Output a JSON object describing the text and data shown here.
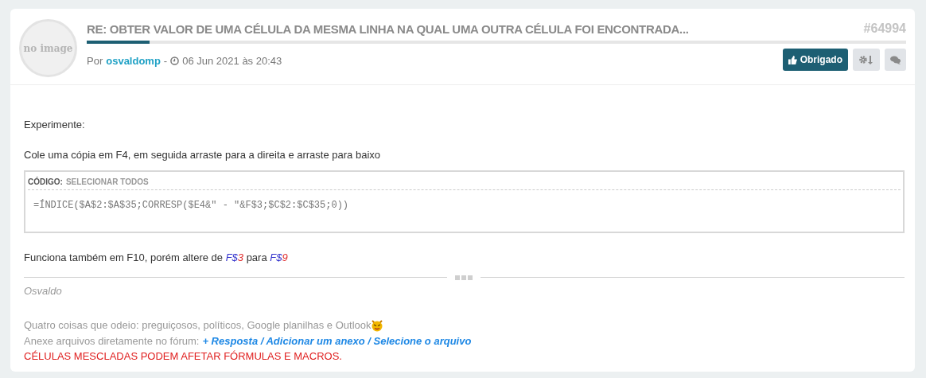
{
  "post": {
    "title": "RE: OBTER VALOR DE UMA CÉLULA DA MESMA LINHA NA QUAL UMA OUTRA CÉLULA FOI ENCONTRADA...",
    "number": "#64994",
    "avatar_text": "no image",
    "by_label": "Por",
    "author": "osvaldomp",
    "separator": "-",
    "date": "06 Jun 2021 às 20:43",
    "thanks_button": "Obrigado"
  },
  "body": {
    "intro": "Experimente:",
    "instruction": "Cole uma cópia em F4, em seguida arraste para a direita e arraste para baixo",
    "code": {
      "label": "CÓDIGO:",
      "select_all": "SELECIONAR TODOS",
      "content": "=ÍNDICE($A$2:$A$35;CORRESP($E4&\" - \"&F$3;$C$2:$C$35;0))"
    },
    "note": [
      {
        "text": "Funciona também em F10, porém altere de ",
        "kind": "plain"
      },
      {
        "text": "F$",
        "kind": "ref",
        "color": "#3333cc"
      },
      {
        "text": "3",
        "kind": "ref",
        "color": "#e03030"
      },
      {
        "text": " para ",
        "kind": "plain"
      },
      {
        "text": "F$",
        "kind": "ref",
        "color": "#3333cc"
      },
      {
        "text": "9",
        "kind": "ref",
        "color": "#e03030"
      }
    ]
  },
  "signature": {
    "name": "Osvaldo",
    "line_1": "Quatro coisas que odeio: preguiçosos, políticos, Google planilhas e Outlook",
    "line_2": "Anexe arquivos diretamente no fórum:",
    "link": "+ Resposta / Adicionar um anexo / Selecione o arquivo",
    "warning": "CÉLULAS MESCLADAS PODEM AFETAR FÓRMULAS E MACROS."
  }
}
